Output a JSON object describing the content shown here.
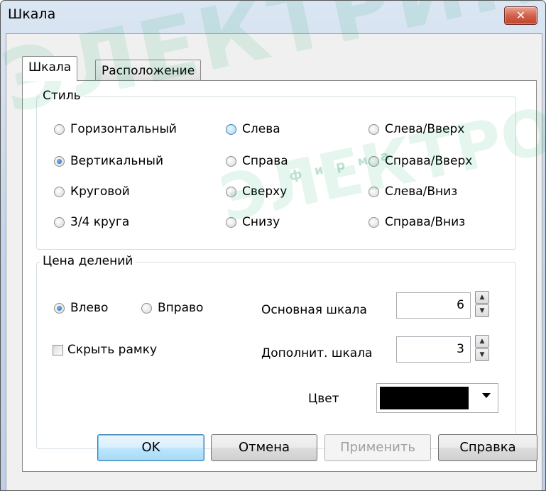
{
  "window": {
    "title": "Шкала",
    "close_glyph": "✕"
  },
  "tabs": [
    {
      "label": "Шкала",
      "active": true
    },
    {
      "label": "Расположение",
      "active": false
    }
  ],
  "style_group": {
    "title": "Стиль",
    "col1": [
      {
        "label": "Горизонтальный",
        "checked": false
      },
      {
        "label": "Вертикальный",
        "checked": true
      },
      {
        "label": "Круговой",
        "checked": false
      },
      {
        "label": "3/4 круга",
        "checked": false
      }
    ],
    "col2": [
      {
        "label": "Слева",
        "checked": false
      },
      {
        "label": "Справа",
        "checked": false
      },
      {
        "label": "Сверху",
        "checked": false
      },
      {
        "label": "Снизу",
        "checked": false
      }
    ],
    "col3": [
      {
        "label": "Слева/Вверх",
        "checked": false
      },
      {
        "label": "Справа/Вверх",
        "checked": false
      },
      {
        "label": "Слева/Вниз",
        "checked": false
      },
      {
        "label": "Справа/Вниз",
        "checked": false
      }
    ]
  },
  "division_group": {
    "title": "Цена делений",
    "left_label": "Влево",
    "right_label": "Вправо",
    "left_checked": true,
    "hide_frame_label": "Скрыть рамку",
    "hide_frame_checked": false,
    "main_scale_label": "Основная шкала",
    "main_scale_value": "6",
    "extra_scale_label": "Дополнит. шкала",
    "extra_scale_value": "3",
    "color_label": "Цвет",
    "color_value": "#000000"
  },
  "buttons": {
    "ok": "OK",
    "cancel": "Отмена",
    "apply": "Применить",
    "help": "Справка"
  },
  "watermark": {
    "text1": "ЭЛЕКТРИКА",
    "text2": "ЭЛЕКТРО",
    "text3": "ф и р м а"
  }
}
